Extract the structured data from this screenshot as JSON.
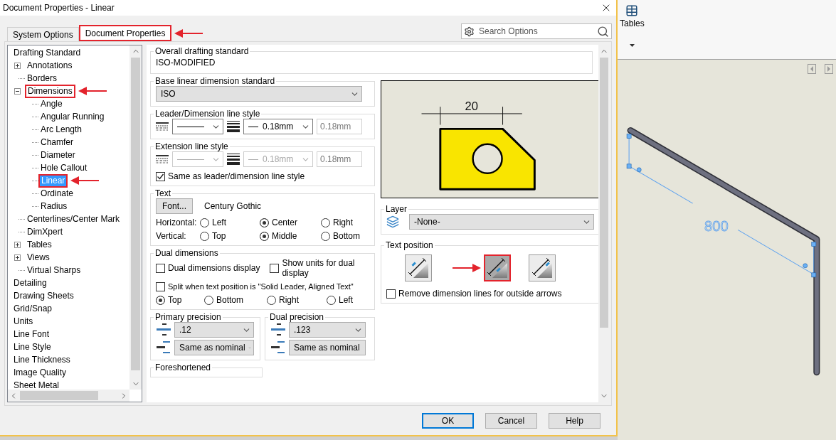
{
  "window": {
    "title": "Document Properties - Linear"
  },
  "tabs": [
    {
      "label": "System Options",
      "selected": false
    },
    {
      "label": "Document Properties",
      "selected": true,
      "callout": true
    }
  ],
  "search": {
    "placeholder": "Search Options"
  },
  "tree": [
    {
      "label": "Drafting Standard",
      "selected": false,
      "children": [
        {
          "label": "Annotations",
          "selected": false,
          "expanded": false
        },
        {
          "label": "Borders",
          "selected": false
        },
        {
          "label": "Dimensions",
          "selected": false,
          "expanded": true,
          "callout": true,
          "children": [
            {
              "label": "Angle",
              "selected": false
            },
            {
              "label": "Angular Running",
              "selected": false
            },
            {
              "label": "Arc Length",
              "selected": false
            },
            {
              "label": "Chamfer",
              "selected": false
            },
            {
              "label": "Diameter",
              "selected": false
            },
            {
              "label": "Hole Callout",
              "selected": false
            },
            {
              "label": "Linear",
              "selected": true,
              "callout": true
            },
            {
              "label": "Ordinate",
              "selected": false
            },
            {
              "label": "Radius",
              "selected": false
            }
          ]
        },
        {
          "label": "Centerlines/Center Mark",
          "selected": false
        },
        {
          "label": "DimXpert",
          "selected": false
        },
        {
          "label": "Tables",
          "selected": false,
          "expanded": false
        },
        {
          "label": "Views",
          "selected": false,
          "expanded": false
        },
        {
          "label": "Virtual Sharps",
          "selected": false
        }
      ]
    },
    {
      "label": "Detailing",
      "selected": false
    },
    {
      "label": "Drawing Sheets",
      "selected": false
    },
    {
      "label": "Grid/Snap",
      "selected": false
    },
    {
      "label": "Units",
      "selected": false
    },
    {
      "label": "Line Font",
      "selected": false
    },
    {
      "label": "Line Style",
      "selected": false
    },
    {
      "label": "Line Thickness",
      "selected": false
    },
    {
      "label": "Image Quality",
      "selected": false
    },
    {
      "label": "Sheet Metal",
      "selected": false
    }
  ],
  "settings": {
    "overall": {
      "title": "Overall drafting standard",
      "value": "ISO-MODIFIED"
    },
    "base_standard": {
      "title": "Base linear dimension standard",
      "value": "ISO"
    },
    "line_styles": [
      {
        "title": "Leader/Dimension line style",
        "thickness": "0.18mm",
        "custom_thickness": "0.18mm",
        "disabled": false
      },
      {
        "title": "Extension line style",
        "thickness": "0.18mm",
        "custom_thickness": "0.18mm",
        "disabled": true,
        "same_as": {
          "label": "Same as leader/dimension line style",
          "checked": true
        }
      }
    ],
    "text": {
      "title": "Text",
      "font_button": "Font...",
      "font_name": "Century Gothic",
      "alignments": [
        {
          "label": "Horizontal:",
          "options": [
            {
              "label": "Left",
              "selected": false
            },
            {
              "label": "Center",
              "selected": true
            },
            {
              "label": "Right",
              "selected": false
            }
          ]
        },
        {
          "label": "Vertical:",
          "options": [
            {
              "label": "Top",
              "selected": false
            },
            {
              "label": "Middle",
              "selected": true
            },
            {
              "label": "Bottom",
              "selected": false
            }
          ]
        }
      ]
    },
    "dual": {
      "title": "Dual dimensions",
      "checkboxes": [
        {
          "label": "Dual dimensions display",
          "checked": false
        },
        {
          "label": "Show units for dual display",
          "checked": false
        },
        {
          "label": "Split when text position is \"Solid Leader, Aligned Text\"",
          "checked": false
        }
      ],
      "positions": [
        {
          "label": "Top",
          "selected": true
        },
        {
          "label": "Bottom",
          "selected": false
        },
        {
          "label": "Right",
          "selected": false
        },
        {
          "label": "Left",
          "selected": false
        }
      ]
    },
    "precision": [
      {
        "title": "Primary precision",
        "value": ".12",
        "tolerance": "Same as nominal"
      },
      {
        "title": "Dual precision",
        "value": ".123",
        "tolerance": "Same as nominal"
      }
    ],
    "foreshortened": {
      "title": "Foreshortened"
    },
    "preview": {
      "dimension": "20"
    },
    "layer": {
      "title": "Layer",
      "value": "-None-"
    },
    "text_position": {
      "title": "Text position",
      "options": [
        {
          "selected": false
        },
        {
          "selected": true,
          "callout": true
        },
        {
          "selected": false
        }
      ],
      "remove_lines": {
        "label": "Remove dimension lines for outside arrows",
        "checked": false
      }
    }
  },
  "buttons": [
    {
      "label": "OK",
      "default": true
    },
    {
      "label": "Cancel",
      "default": false
    },
    {
      "label": "Help",
      "default": false
    }
  ],
  "ribbon": {
    "tables": "Tables"
  },
  "viewport": {
    "dimension": "800"
  }
}
